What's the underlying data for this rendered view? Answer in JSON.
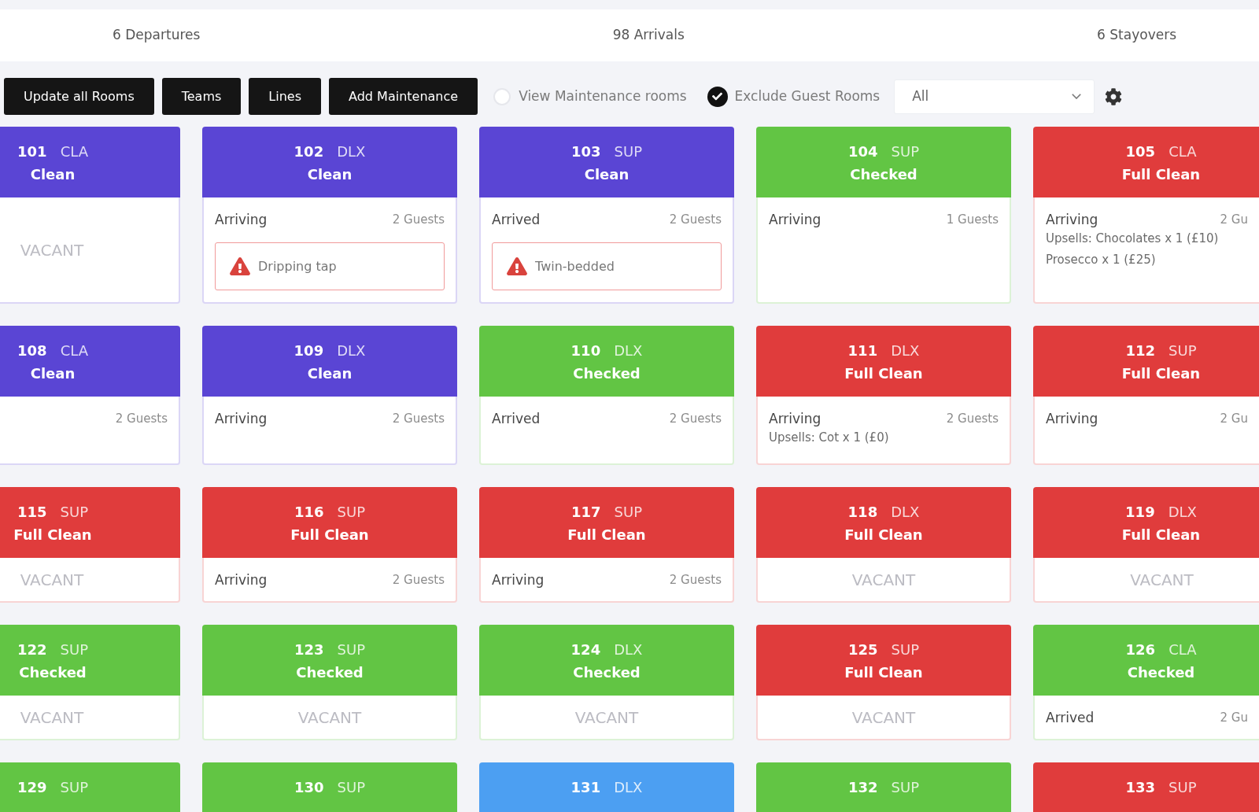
{
  "stats": [
    "6 Departures",
    "98 Arrivals",
    "6 Stayovers"
  ],
  "toolbar": {
    "buttons": [
      "Update all Rooms",
      "Teams",
      "Lines",
      "Add Maintenance"
    ],
    "toggles": [
      {
        "label": "View Maintenance rooms",
        "checked": false
      },
      {
        "label": "Exclude Guest Rooms",
        "checked": true
      }
    ],
    "filter": {
      "value": "All"
    }
  },
  "rooms": [
    {
      "number": "101",
      "type": "CLA",
      "status": "Clean",
      "color": "#5a45d4",
      "kind": "vacant",
      "vacant_label": "VACANT"
    },
    {
      "number": "102",
      "type": "DLX",
      "status": "Clean",
      "color": "#5a45d4",
      "kind": "occupied",
      "arrival": "Arriving",
      "guests": "2 Guests",
      "alert": "Dripping tap"
    },
    {
      "number": "103",
      "type": "SUP",
      "status": "Clean",
      "color": "#5a45d4",
      "kind": "occupied",
      "arrival": "Arrived",
      "guests": "2 Guests",
      "alert": "Twin-bedded"
    },
    {
      "number": "104",
      "type": "SUP",
      "status": "Checked",
      "color": "#62c544",
      "kind": "occupied",
      "arrival": "Arriving",
      "guests": "1 Guests"
    },
    {
      "number": "105",
      "type": "CLA",
      "status": "Full Clean",
      "color": "#e03c3c",
      "kind": "occupied",
      "arrival": "Arriving",
      "guests": "2 Gu",
      "note": "Upsells: Chocolates x 1 (£10) Prosecco x 1 (£25)"
    },
    {
      "number": "108",
      "type": "CLA",
      "status": "Clean",
      "color": "#5a45d4",
      "kind": "occupied",
      "guests": "2 Guests"
    },
    {
      "number": "109",
      "type": "DLX",
      "status": "Clean",
      "color": "#5a45d4",
      "kind": "occupied",
      "arrival": "Arriving",
      "guests": "2 Guests"
    },
    {
      "number": "110",
      "type": "DLX",
      "status": "Checked",
      "color": "#62c544",
      "kind": "occupied",
      "arrival": "Arrived",
      "guests": "2 Guests"
    },
    {
      "number": "111",
      "type": "DLX",
      "status": "Full Clean",
      "color": "#e03c3c",
      "kind": "occupied",
      "arrival": "Arriving",
      "guests": "2 Guests",
      "note": "Upsells: Cot x 1 (£0)"
    },
    {
      "number": "112",
      "type": "SUP",
      "status": "Full Clean",
      "color": "#e03c3c",
      "kind": "occupied",
      "arrival": "Arriving",
      "guests": "2 Gu"
    },
    {
      "number": "115",
      "type": "SUP",
      "status": "Full Clean",
      "color": "#e03c3c",
      "kind": "vacant",
      "vacant_label": "VACANT"
    },
    {
      "number": "116",
      "type": "SUP",
      "status": "Full Clean",
      "color": "#e03c3c",
      "kind": "occupied",
      "arrival": "Arriving",
      "guests": "2 Guests"
    },
    {
      "number": "117",
      "type": "SUP",
      "status": "Full Clean",
      "color": "#e03c3c",
      "kind": "occupied",
      "arrival": "Arriving",
      "guests": "2 Guests"
    },
    {
      "number": "118",
      "type": "DLX",
      "status": "Full Clean",
      "color": "#e03c3c",
      "kind": "vacant",
      "vacant_label": "VACANT"
    },
    {
      "number": "119",
      "type": "DLX",
      "status": "Full Clean",
      "color": "#e03c3c",
      "kind": "vacant",
      "vacant_label": "VACANT"
    },
    {
      "number": "122",
      "type": "SUP",
      "status": "Checked",
      "color": "#62c544",
      "kind": "vacant",
      "vacant_label": "VACANT"
    },
    {
      "number": "123",
      "type": "SUP",
      "status": "Checked",
      "color": "#62c544",
      "kind": "vacant",
      "vacant_label": "VACANT"
    },
    {
      "number": "124",
      "type": "DLX",
      "status": "Checked",
      "color": "#62c544",
      "kind": "vacant",
      "vacant_label": "VACANT"
    },
    {
      "number": "125",
      "type": "SUP",
      "status": "Full Clean",
      "color": "#e03c3c",
      "kind": "vacant",
      "vacant_label": "VACANT"
    },
    {
      "number": "126",
      "type": "CLA",
      "status": "Checked",
      "color": "#62c544",
      "kind": "occupied",
      "arrival": "Arrived",
      "guests": "2 Gu"
    },
    {
      "number": "129",
      "type": "SUP",
      "color": "#62c544"
    },
    {
      "number": "130",
      "type": "SUP",
      "color": "#62c544"
    },
    {
      "number": "131",
      "type": "DLX",
      "color": "#4c9ff2"
    },
    {
      "number": "132",
      "type": "SUP",
      "color": "#62c544"
    },
    {
      "number": "133",
      "type": "SUP",
      "color": "#e03c3c"
    }
  ]
}
